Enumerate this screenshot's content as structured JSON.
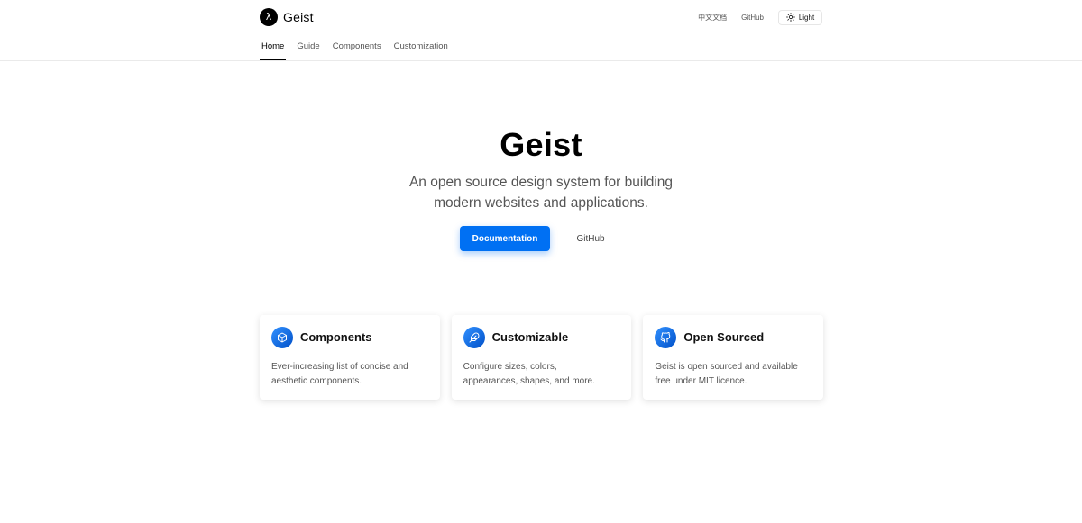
{
  "header": {
    "brand": {
      "logo_glyph": "λ",
      "name": "Geist"
    },
    "links": {
      "chinese_docs": "中文文档",
      "github": "GitHub"
    },
    "theme": {
      "label": "Light",
      "icon": "sun-icon"
    },
    "tabs": [
      {
        "label": "Home",
        "active": true
      },
      {
        "label": "Guide",
        "active": false
      },
      {
        "label": "Components",
        "active": false
      },
      {
        "label": "Customization",
        "active": false
      }
    ]
  },
  "hero": {
    "title": "Geist",
    "subtitle_line1": "An open source design system for building",
    "subtitle_line2": "modern websites and applications.",
    "primary_button": "Documentation",
    "secondary_button": "GitHub"
  },
  "cards": [
    {
      "icon": "package-icon",
      "title": "Components",
      "desc_line1": "Ever-increasing list of concise and",
      "desc_line2": "aesthetic components."
    },
    {
      "icon": "feather-icon",
      "title": "Customizable",
      "desc_line1": "Configure sizes, colors,",
      "desc_line2": "appearances, shapes, and more."
    },
    {
      "icon": "github-icon",
      "title": "Open Sourced",
      "desc_line1": "Geist is open sourced and available",
      "desc_line2": "free under MIT licence."
    }
  ],
  "colors": {
    "accent": "#0070f3",
    "text": "#000000",
    "muted": "#555555",
    "border": "#eaeaea"
  }
}
